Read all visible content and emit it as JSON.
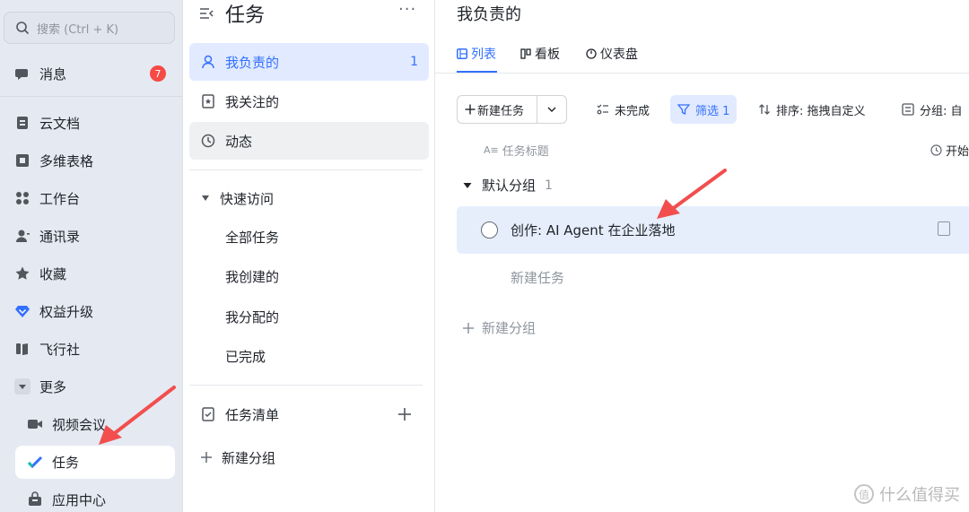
{
  "left_nav": {
    "search_placeholder": "搜索 (Ctrl + K)",
    "items": [
      {
        "label": "消息",
        "icon": "chat-bubble-icon",
        "badge": "7"
      },
      {
        "label": "云文档",
        "icon": "document-icon"
      },
      {
        "label": "多维表格",
        "icon": "table-icon"
      },
      {
        "label": "工作台",
        "icon": "grid-icon"
      },
      {
        "label": "通讯录",
        "icon": "contacts-icon"
      },
      {
        "label": "收藏",
        "icon": "star-icon"
      },
      {
        "label": "权益升级",
        "icon": "diamond-icon"
      },
      {
        "label": "飞行社",
        "icon": "book-icon"
      },
      {
        "label": "更多",
        "icon": "caret-down-icon"
      },
      {
        "label": "视频会议",
        "icon": "video-icon"
      },
      {
        "label": "任务",
        "icon": "check-icon"
      },
      {
        "label": "应用中心",
        "icon": "bag-icon"
      }
    ]
  },
  "mid_panel": {
    "title": "任务",
    "more": "···",
    "items": [
      {
        "label": "我负责的",
        "count": "1"
      },
      {
        "label": "我关注的"
      },
      {
        "label": "动态"
      }
    ],
    "quick_access": {
      "label": "快速访问",
      "items": [
        "全部任务",
        "我创建的",
        "我分配的",
        "已完成"
      ]
    },
    "task_list_label": "任务清单",
    "new_group_label": "新建分组"
  },
  "main": {
    "title": "我负责的",
    "tabs": [
      "列表",
      "看板",
      "仪表盘"
    ],
    "toolbar": {
      "new_task": "新建任务",
      "incomplete": "未完成",
      "filter": "筛选 1",
      "sort": "排序: 拖拽自定义",
      "group": "分组: 自"
    },
    "columns": {
      "title": "任务标题",
      "start": "开始"
    },
    "group": {
      "name": "默认分组",
      "count": "1"
    },
    "task": {
      "title": "创作: AI Agent 在企业落地"
    },
    "new_task_inline": "新建任务",
    "new_group": "新建分组"
  },
  "colors": {
    "accent": "#3370ff",
    "badge": "#f54a45",
    "arrow": "#f24e4e"
  },
  "watermark": "什么值得买"
}
